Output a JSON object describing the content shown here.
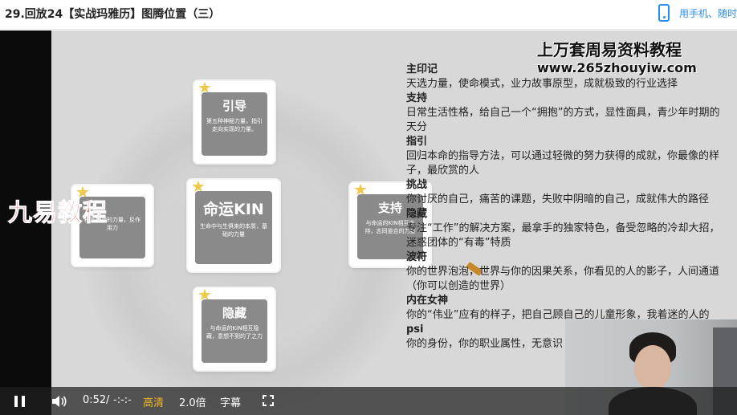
{
  "header": {
    "title": "29.回放24【实战玛雅历】图腾位置（三）",
    "phone_link": "用手机、随时"
  },
  "slide": {
    "watermark_left": "九易教程",
    "watermark_top": "上万套周易资料教程",
    "watermark_url": "www.265zhouyiw.com",
    "glyphs": {
      "guide": {
        "name": "引导",
        "desc": "第五种神秘力量，指引走向实现的力量。"
      },
      "destiny": {
        "name": "命运KIN",
        "desc": "生命中与生俱来的本质，基础的力量"
      },
      "analog": {
        "name": "支持",
        "desc": "与命运的KIN相互支持，志同道合的力量"
      },
      "antipode": {
        "name": "",
        "desc": "相互挑战的力量，反作用力"
      },
      "occult": {
        "name": "隐藏",
        "desc": "与命运的KIN相互隐藏，意想不到的了之力"
      }
    },
    "text_items": [
      {
        "heading": "主印记",
        "body": "天选力量，使命模式，业力故事原型，成就极致的行业选择"
      },
      {
        "heading": "支持",
        "body": "日常生活性格，给自己一个“拥抱”的方式，显性面具，青少年时期的天分"
      },
      {
        "heading": "指引",
        "body": "回归本命的指导方法，可以通过轻微的努力获得的成就，你最像的样子，最欣赏的人"
      },
      {
        "heading": "挑战",
        "body": "你讨厌的自己，痛苦的课题，失败中阴暗的自己，成就伟大的路径"
      },
      {
        "heading": "隐藏",
        "body": "专注“工作”的解决方案，最拿手的独家特色，备受忽略的冷却大招，迷惑团体的“有毒”特质"
      },
      {
        "heading": "波符",
        "body": "你的世界泡泡，世界与你的因果关系，你看见的人的影子，人间通道（你可以创造的世界）"
      },
      {
        "heading": "内在女神",
        "body": "你的“伟业”应有的样子，把自己顾自己的儿童形象，我着迷的人的"
      },
      {
        "heading": "psi",
        "body": "你的身份，你的职业属性，无意识"
      }
    ]
  },
  "controls": {
    "current_time": "0:52",
    "separator": "/",
    "duration": "-:-:-",
    "quality": "高清",
    "speed": "2.0倍",
    "subtitles": "字幕"
  },
  "colors": {
    "accent": "#2a8ef0",
    "quality_label": "#f0b429",
    "watermark_red": "#d0312d"
  },
  "icons": [
    "phone-icon",
    "pause-icon",
    "volume-icon",
    "fullscreen-icon",
    "star-icon"
  ]
}
